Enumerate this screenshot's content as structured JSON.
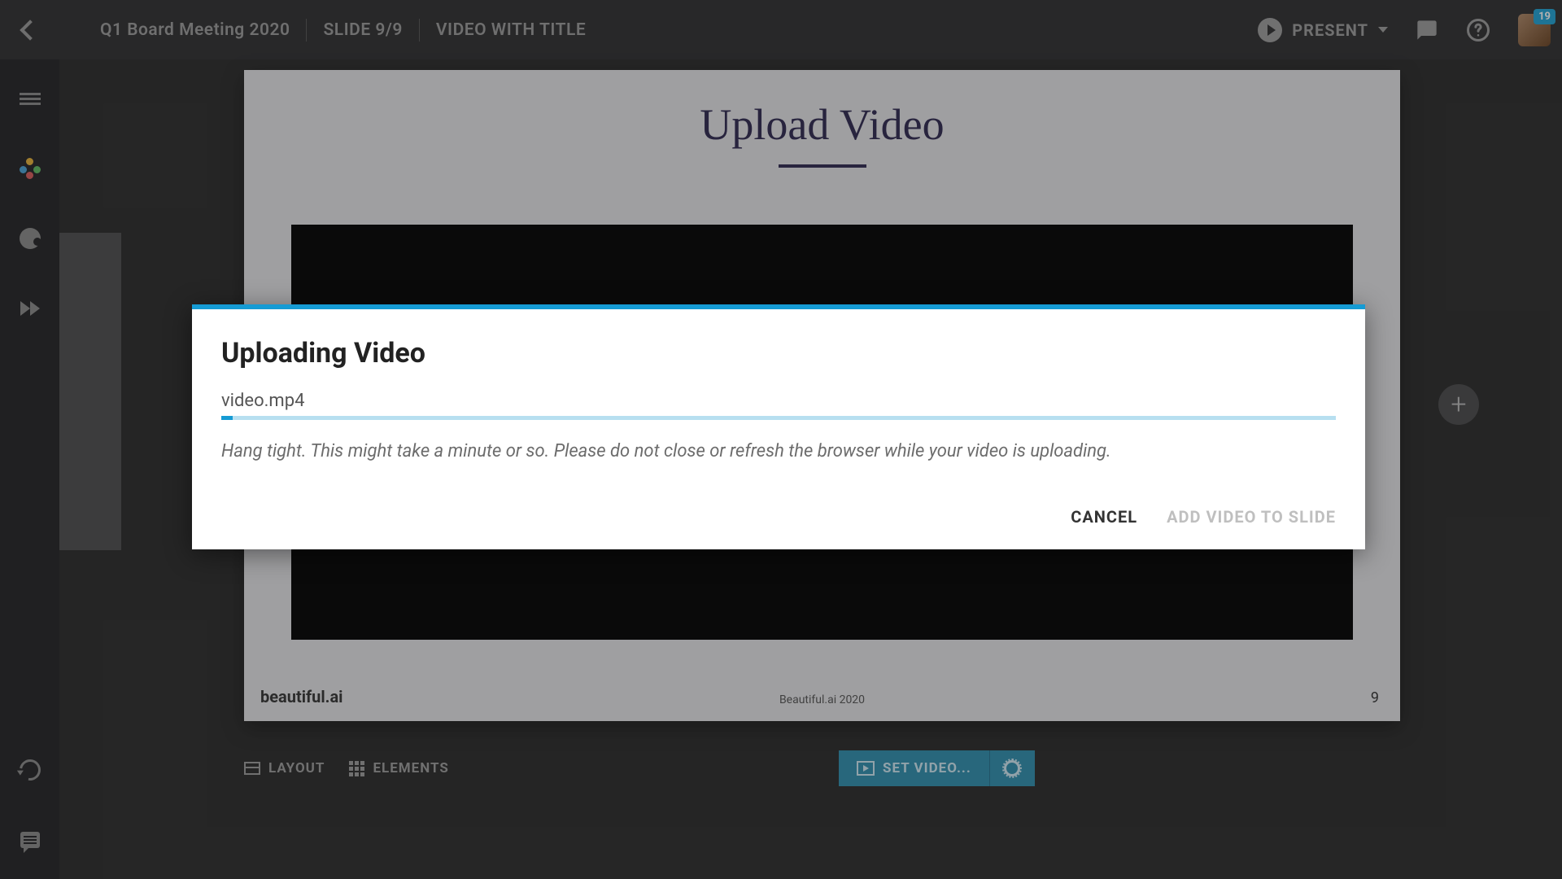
{
  "header": {
    "presentation_title": "Q1 Board Meeting 2020",
    "slide_indicator": "SLIDE 9/9",
    "slide_type": "VIDEO WITH TITLE",
    "present_label": "PRESENT",
    "notification_count": "19"
  },
  "slide": {
    "title": "Upload Video",
    "brand": "beautiful.ai",
    "footer_center": "Beautiful.ai 2020",
    "page_number": "9"
  },
  "toolbar": {
    "layout_label": "LAYOUT",
    "elements_label": "ELEMENTS",
    "set_video_label": "SET VIDEO..."
  },
  "modal": {
    "title": "Uploading Video",
    "filename": "video.mp4",
    "message": "Hang tight. This might take a minute or so. Please do not close or refresh the browser while your video is uploading.",
    "cancel_label": "CANCEL",
    "confirm_label": "ADD VIDEO TO SLIDE",
    "progress_percent": 1
  }
}
